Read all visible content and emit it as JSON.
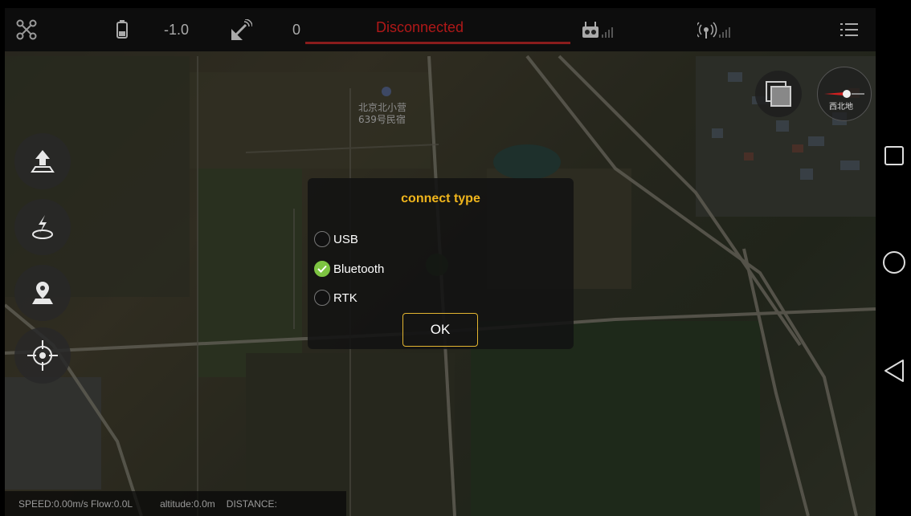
{
  "topbar": {
    "battery_value": "-1.0",
    "satellite_count": "0",
    "status": "Disconnected"
  },
  "map": {
    "poi_label_line1": "北京北小营",
    "poi_label_line2": "639号民宿",
    "compass_label": "西北地"
  },
  "dialog": {
    "title": "connect type",
    "options": [
      {
        "label": "USB",
        "checked": false
      },
      {
        "label": "Bluetooth",
        "checked": true
      },
      {
        "label": "RTK",
        "checked": false
      }
    ],
    "ok_label": "OK"
  },
  "infobar": {
    "speed_flow": "SPEED:0.00m/s Flow:0.0L",
    "altitude": "altitude:0.0m",
    "distance": "DISTANCE:"
  },
  "colors": {
    "accent": "#f0b51c",
    "status_red": "#b01818",
    "checked_green": "#7dc442"
  }
}
